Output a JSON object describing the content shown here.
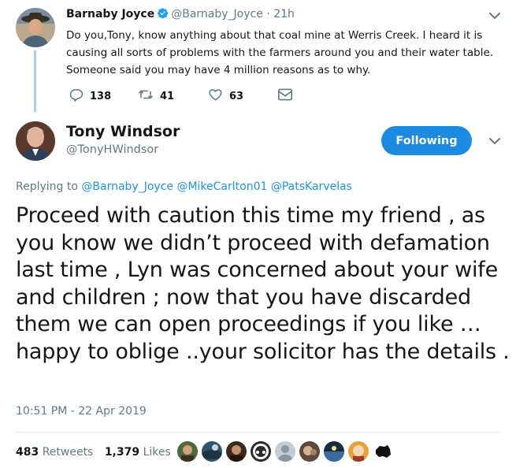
{
  "reply_tweet": {
    "display_name": "Barnaby Joyce",
    "handle": "@Barnaby_Joyce",
    "time": "21h",
    "text": "Do you,Tony, know anything about that coal mine at Werris Creek. I heard it is causing all sorts of problems with the farmers around you and their water table. Someone said you may have 4 million reasons as to why.",
    "replies": "138",
    "retweets": "41",
    "likes": "63"
  },
  "main_tweet": {
    "display_name": "Tony Windsor",
    "handle": "@TonyHWindsor",
    "follow_label": "Following",
    "replying_prefix": "Replying to",
    "replying_to": [
      "@Barnaby_Joyce",
      "@MikeCarlton01",
      "@PatsKarvelas"
    ],
    "text": "Proceed with caution this time my friend , as you know we didn’t proceed with defamation last time , Lyn was concerned about your wife and children ; now that you have discarded them we can open proceedings if you like …happy to oblige ..your solicitor has the details .",
    "timestamp": "10:51 PM - 22 Apr 2019",
    "retweets_count": "483",
    "retweets_label": "Retweets",
    "likes_count": "1,379",
    "likes_label": "Likes"
  },
  "colors": {
    "accent": "#1d8ae2",
    "link": "#1b95e0",
    "muted": "#657786",
    "thread_line": "#9fd2f5"
  },
  "icons": [
    "verified-badge-icon",
    "chevron-down-icon",
    "reply-icon",
    "retweet-icon",
    "like-icon",
    "direct-message-icon"
  ]
}
